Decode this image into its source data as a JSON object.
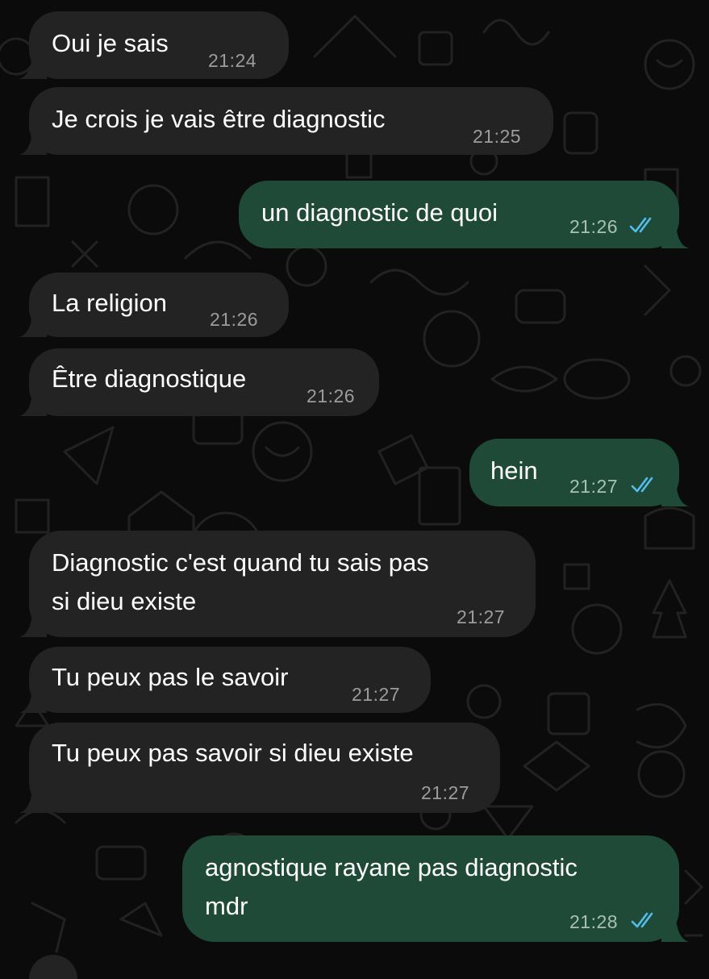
{
  "colors": {
    "background": "#0b0b0b",
    "incoming_bubble": "#232323",
    "outgoing_bubble": "#1f4a37",
    "message_text": "#ffffff",
    "timestamp": "#9c9c9c",
    "read_checks": "#53bdeb"
  },
  "messages": [
    {
      "direction": "incoming",
      "lines": [
        "Oui je sais"
      ],
      "time": "21:24"
    },
    {
      "direction": "incoming",
      "lines": [
        "Je crois je vais être diagnostic"
      ],
      "time": "21:25"
    },
    {
      "direction": "outgoing",
      "lines": [
        "un diagnostic de quoi"
      ],
      "time": "21:26",
      "status_icon": "double-check-read-icon"
    },
    {
      "direction": "incoming",
      "lines": [
        "La religion"
      ],
      "time": "21:26"
    },
    {
      "direction": "incoming",
      "lines": [
        "Être diagnostique"
      ],
      "time": "21:26"
    },
    {
      "direction": "outgoing",
      "lines": [
        "hein"
      ],
      "time": "21:27",
      "status_icon": "double-check-read-icon"
    },
    {
      "direction": "incoming",
      "lines": [
        "Diagnostic c'est quand tu sais pas",
        "si dieu existe"
      ],
      "time": "21:27"
    },
    {
      "direction": "incoming",
      "lines": [
        "Tu peux pas le savoir"
      ],
      "time": "21:27"
    },
    {
      "direction": "incoming",
      "lines": [
        "Tu peux pas savoir si dieu existe"
      ],
      "time": "21:27"
    },
    {
      "direction": "outgoing",
      "lines": [
        "agnostique rayane pas diagnostic",
        "mdr"
      ],
      "time": "21:28",
      "status_icon": "double-check-read-icon"
    }
  ]
}
